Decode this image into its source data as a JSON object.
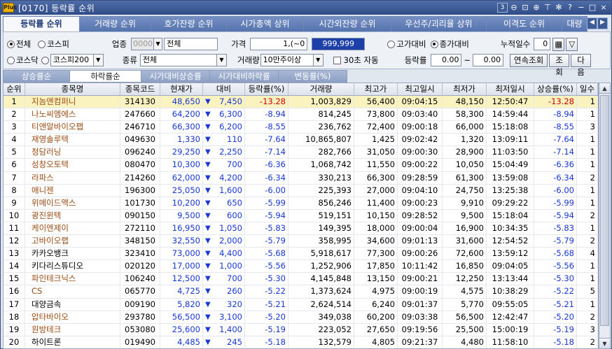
{
  "window": {
    "title": "[0170] 등락률 순위",
    "logo": "Plus",
    "page_no": "3"
  },
  "tabs": [
    "등락률 순위",
    "거래량 순위",
    "호가잔량 순위",
    "시가총액 상위",
    "시간외잔량 순위",
    "우선주/괴리율 상위",
    "이격도 순위",
    "대량"
  ],
  "filters": {
    "market_all": "전체",
    "market_kospi": "코스피",
    "market_kosdaq": "코스닥",
    "market_select": "코스피200",
    "industry_label": "업종",
    "industry_code": "0000",
    "industry_name": "전체",
    "type_label": "종류",
    "type_value": "전체",
    "price_label": "가격",
    "price_from": "1,(~0",
    "price_to": "999,999",
    "volume_label": "거래량",
    "volume_value": "10만주이상",
    "auto30_label": "30초 자동",
    "rate_label": "등락률",
    "rate_from": "0.00",
    "rate_tilde": "~",
    "rate_to": "0.00",
    "high_compare": "고가대비",
    "close_compare": "종가대비",
    "cum_days_label": "누적일수",
    "cum_days": "0",
    "btn_continuous": "연속조회",
    "btn_query": "조회",
    "btn_next": "다음"
  },
  "subtabs": [
    "상승률순",
    "하락률순",
    "시가대비상승률",
    "시가대비하락률",
    "변동률(%)"
  ],
  "columns": [
    "순위",
    "종목명",
    "종목코드",
    "현재가",
    "대비",
    "등락률(%)",
    "거래량",
    "최고가",
    "최고일시",
    "최저가",
    "최저일시",
    "상승률(%)",
    "일수"
  ],
  "rows": [
    [
      "1",
      "지놈앤컴퍼니",
      "314130",
      "48,650",
      "7,450",
      "-13.28",
      "1,003,829",
      "56,400",
      "09:04:15",
      "48,150",
      "12:50:47",
      "-13.28",
      "1"
    ],
    [
      "2",
      "나노씨엠에스",
      "247660",
      "64,200",
      "6,300",
      "-8.94",
      "814,245",
      "73,800",
      "09:03:40",
      "58,300",
      "14:59:44",
      "-8.94",
      "1"
    ],
    [
      "3",
      "티앤알바이오팹",
      "246710",
      "66,300",
      "6,200",
      "-8.55",
      "236,762",
      "72,400",
      "09:00:18",
      "66,000",
      "15:18:08",
      "-8.55",
      "3"
    ],
    [
      "4",
      "재영솔루텍",
      "049630",
      "1,330",
      "110",
      "-7.64",
      "10,865,807",
      "1,425",
      "09:02:42",
      "1,320",
      "13:09:11",
      "-7.64",
      "1"
    ],
    [
      "5",
      "청담러닝",
      "096240",
      "29,250",
      "2,250",
      "-7.14",
      "282,766",
      "31,050",
      "09:00:30",
      "28,900",
      "11:03:50",
      "-7.14",
      "1"
    ],
    [
      "6",
      "성창오토텍",
      "080470",
      "10,300",
      "700",
      "-6.36",
      "1,068,742",
      "11,550",
      "09:00:22",
      "10,050",
      "15:04:49",
      "-6.36",
      "1"
    ],
    [
      "7",
      "라파스",
      "214260",
      "62,000",
      "4,200",
      "-6.34",
      "330,213",
      "66,300",
      "09:28:59",
      "61,300",
      "13:59:08",
      "-6.34",
      "2"
    ],
    [
      "8",
      "애니젠",
      "196300",
      "25,050",
      "1,600",
      "-6.00",
      "225,393",
      "27,000",
      "09:04:10",
      "24,750",
      "13:25:38",
      "-6.00",
      "1"
    ],
    [
      "9",
      "위메이드맥스",
      "101730",
      "10,200",
      "650",
      "-5.99",
      "856,246",
      "11,400",
      "09:00:23",
      "9,910",
      "09:29:22",
      "-5.99",
      "1"
    ],
    [
      "10",
      "광진윈텍",
      "090150",
      "9,500",
      "600",
      "-5.94",
      "519,151",
      "10,150",
      "09:28:52",
      "9,500",
      "15:18:04",
      "-5.94",
      "2"
    ],
    [
      "11",
      "케이엔제이",
      "272110",
      "16,950",
      "1,050",
      "-5.83",
      "149,395",
      "18,000",
      "09:00:04",
      "16,900",
      "10:34:35",
      "-5.83",
      "1"
    ],
    [
      "12",
      "고바이오랩",
      "348150",
      "32,550",
      "2,000",
      "-5.79",
      "358,995",
      "34,600",
      "09:01:13",
      "31,600",
      "12:54:52",
      "-5.79",
      "2"
    ],
    [
      "13",
      "카카오뱅크",
      "323410",
      "73,000",
      "4,400",
      "-5.68",
      "5,918,617",
      "77,300",
      "09:00:26",
      "72,600",
      "13:59:12",
      "-5.68",
      "4"
    ],
    [
      "14",
      "키다리스튜디오",
      "020120",
      "17,000",
      "1,000",
      "-5.56",
      "1,252,906",
      "17,850",
      "10:11:42",
      "16,850",
      "09:04:05",
      "-5.56",
      "1"
    ],
    [
      "15",
      "파인테크닉스",
      "106240",
      "12,500",
      "700",
      "-5.30",
      "4,145,848",
      "13,150",
      "09:00:21",
      "12,250",
      "13:13:44",
      "-5.30",
      "1"
    ],
    [
      "16",
      "CS",
      "065770",
      "4,725",
      "260",
      "-5.22",
      "1,373,624",
      "4,975",
      "09:00:19",
      "4,575",
      "10:38:29",
      "-5.22",
      "5"
    ],
    [
      "17",
      "대양금속",
      "009190",
      "5,820",
      "320",
      "-5.21",
      "2,624,514",
      "6,240",
      "09:01:37",
      "5,770",
      "09:55:05",
      "-5.21",
      "1"
    ],
    [
      "18",
      "압타바이오",
      "293780",
      "56,500",
      "3,100",
      "-5.20",
      "349,038",
      "60,200",
      "09:03:38",
      "56,500",
      "12:42:47",
      "-5.20",
      "2"
    ],
    [
      "19",
      "원방테크",
      "053080",
      "25,600",
      "1,400",
      "-5.19",
      "223,052",
      "27,650",
      "09:19:56",
      "25,500",
      "15:00:19",
      "-5.19",
      "3"
    ],
    [
      "20",
      "하이트론",
      "019490",
      "4,485",
      "245",
      "-5.18",
      "132,579",
      "4,805",
      "09:21:37",
      "4,480",
      "11:58:10",
      "-5.18",
      "2"
    ]
  ],
  "brown_rows": [
    "1",
    "2",
    "3",
    "4",
    "5",
    "6",
    "7",
    "8",
    "9",
    "10",
    "11",
    "12",
    "15",
    "16",
    "18",
    "19"
  ]
}
